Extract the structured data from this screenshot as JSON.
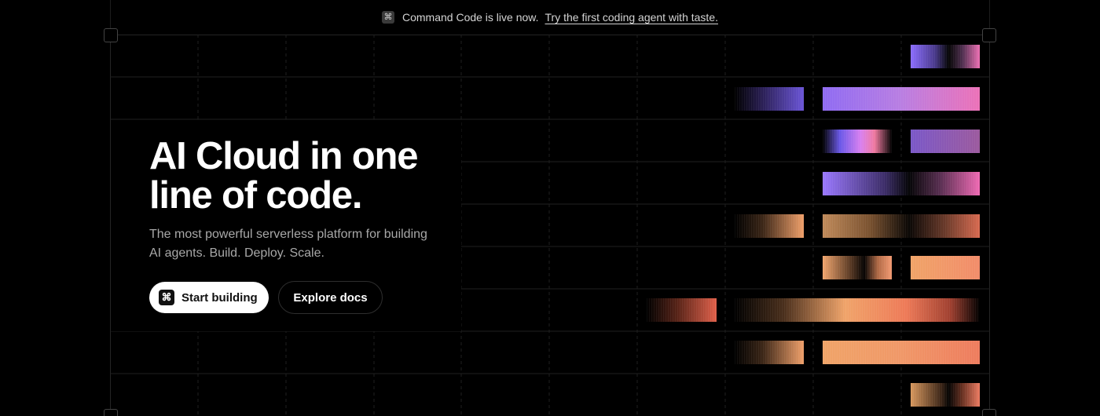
{
  "announcement": {
    "icon": "command-icon",
    "text": "Command Code is live now.",
    "link_text": "Try the first coding agent with taste."
  },
  "hero": {
    "title": "AI Cloud in one line of code.",
    "subtitle": "The most powerful serverless platform for building AI agents. Build. Deploy. Scale.",
    "primary_button": {
      "label": "Start building",
      "icon": "command-icon"
    },
    "secondary_button": {
      "label": "Explore docs"
    }
  },
  "colors": {
    "background": "#000000",
    "grid_line": "#242424",
    "purple_accent": "#8f6bf2",
    "pink_accent": "#ec72b8",
    "orange_accent": "#f0a468",
    "coral_accent": "#ee7c5e"
  }
}
